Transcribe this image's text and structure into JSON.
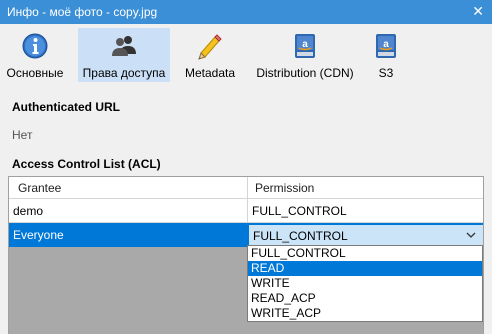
{
  "window": {
    "title": "Инфо - моё фото - copy.jpg",
    "close_glyph": "✕"
  },
  "toolbar": {
    "tabs": [
      {
        "label": "Основные",
        "icon": "info-icon"
      },
      {
        "label": "Права доступа",
        "icon": "users-icon",
        "active": true
      },
      {
        "label": "Metadata",
        "icon": "pencil-icon"
      },
      {
        "label": "Distribution (CDN)",
        "icon": "amazon-drive-icon"
      },
      {
        "label": "S3",
        "icon": "amazon-drive-icon"
      }
    ]
  },
  "authenticated_url": {
    "title": "Authenticated URL",
    "value": "Нет"
  },
  "acl": {
    "title": "Access Control List (ACL)",
    "columns": [
      "Grantee",
      "Permission"
    ],
    "rows": [
      {
        "grantee": "demo",
        "permission": "FULL_CONTROL"
      },
      {
        "grantee": "Everyone",
        "permission": "FULL_CONTROL"
      }
    ]
  },
  "permission_dropdown": {
    "selected_value": "FULL_CONTROL",
    "highlighted": "READ",
    "options": [
      "FULL_CONTROL",
      "READ",
      "WRITE",
      "READ_ACP",
      "WRITE_ACP"
    ]
  },
  "colors": {
    "titlebar": "#3a8fd6",
    "selection": "#0078d7",
    "active_tab": "#cbe0f6",
    "empty_area": "#a9a9a9"
  }
}
